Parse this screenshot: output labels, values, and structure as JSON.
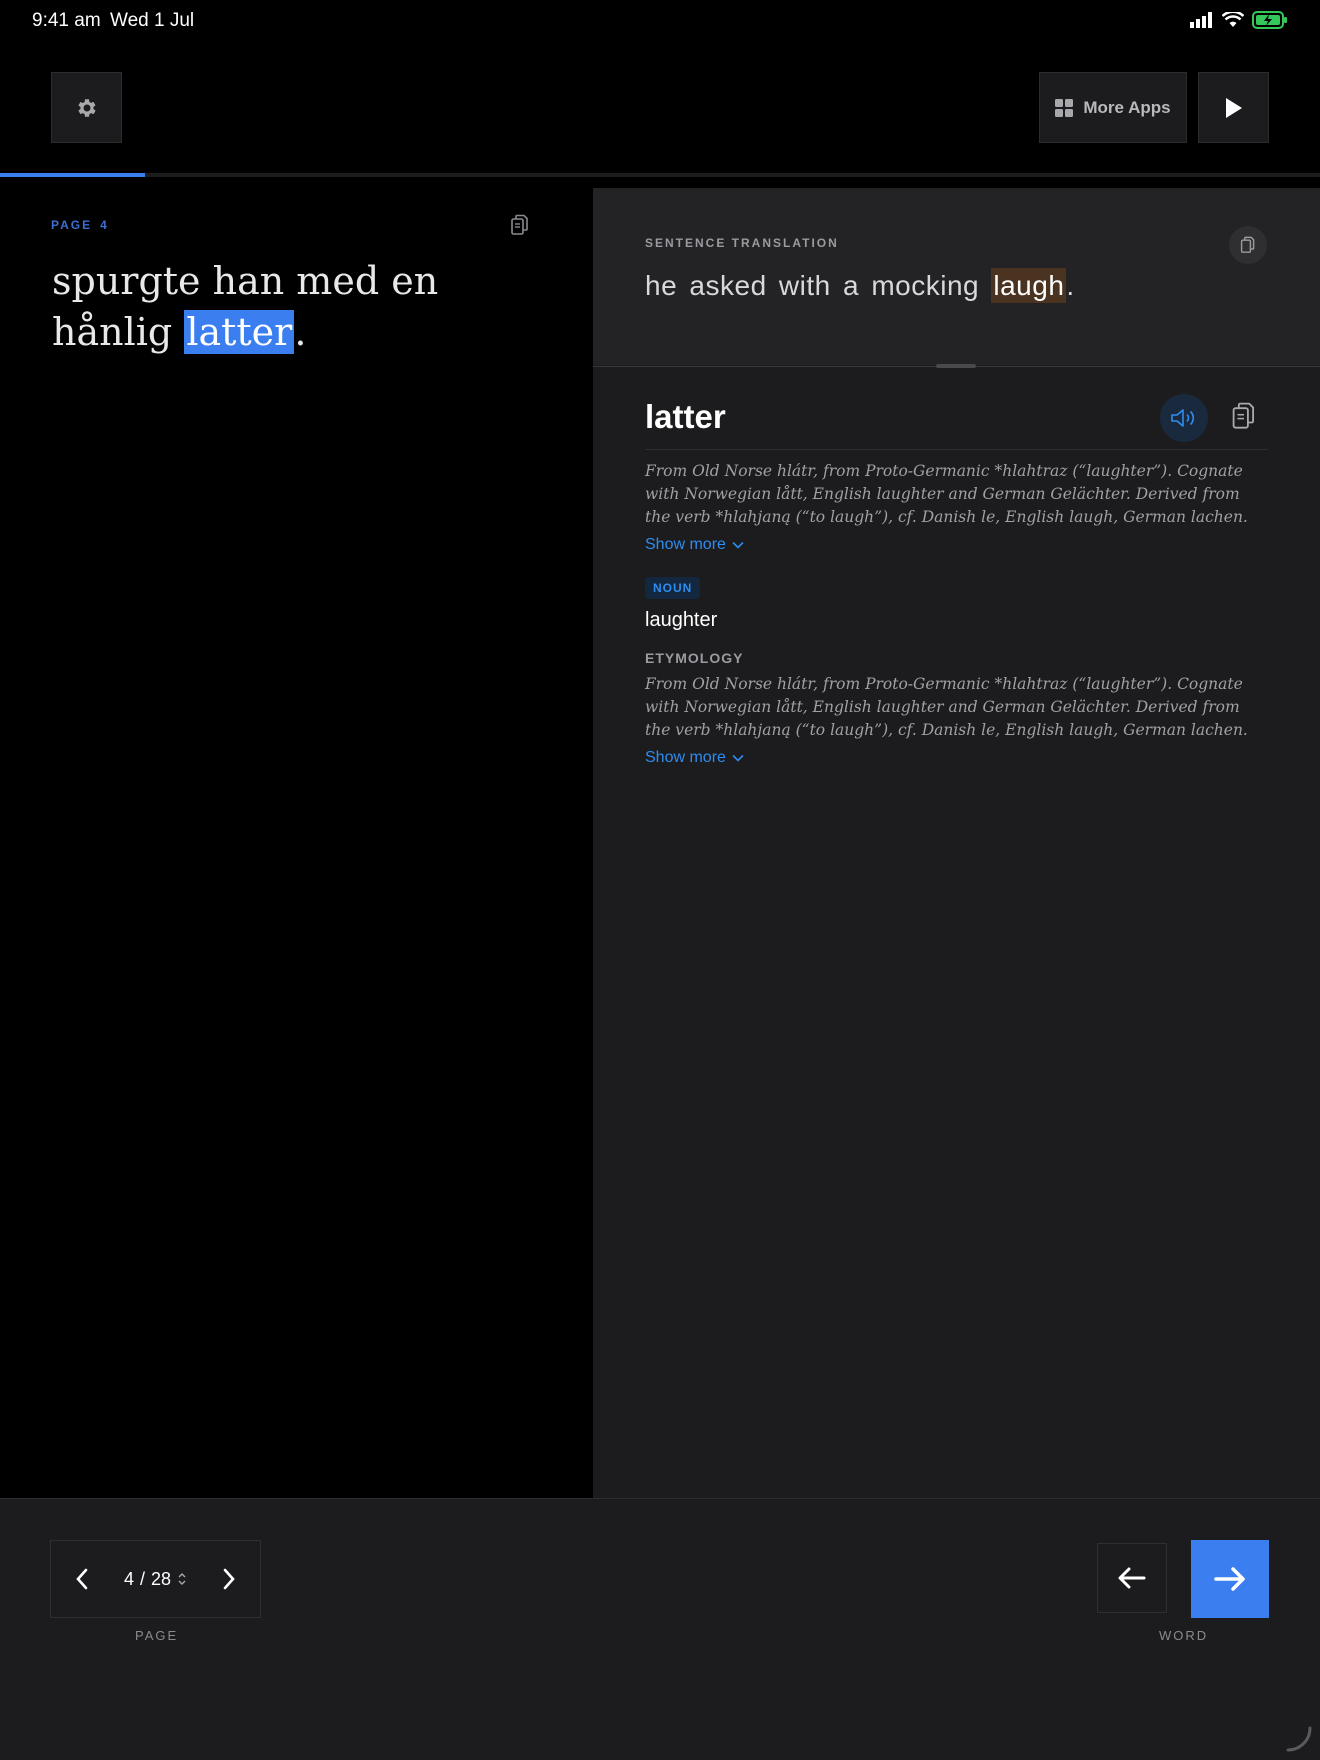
{
  "status_bar": {
    "time": "9:41 am",
    "date": "Wed 1 Jul"
  },
  "toolbar": {
    "more_apps_label": "More Apps"
  },
  "progress": {
    "fraction": 0.11
  },
  "reader": {
    "page_label": "PAGE",
    "page_number": "4",
    "sentence_before": "spurgte han med en hånlig ",
    "highlighted_word": "latter",
    "sentence_after": "."
  },
  "translation": {
    "label": "SENTENCE TRANSLATION",
    "text_before": "he asked with a mocking ",
    "highlighted_word": "laugh",
    "text_after": "."
  },
  "entry": {
    "word": "latter",
    "etymology_summary": "From Old Norse hlátr, from Proto-Germanic *hlahtraz (“laughter”). Cognate with Norwegian lått, English laughter and German Gelächter. Derived from the verb *hlahjaną (“to laugh”), cf. Danish le, English laugh, German lachen.",
    "show_more_label": "Show more",
    "part_of_speech": "NOUN",
    "meaning": "laughter",
    "etymology_label": "ETYMOLOGY",
    "etymology_text": "From Old Norse hlátr, from Proto-Germanic *hlahtraz (“laughter”). Cognate with Norwegian lått, English laughter and German Gelächter. Derived from the verb *hlahjaną (“to laugh”), cf. Danish le, English laugh, German lachen.",
    "show_more_label_2": "Show more"
  },
  "pager": {
    "current": "4",
    "separator": "/",
    "total": "28",
    "caption": "PAGE"
  },
  "word_nav": {
    "caption": "WORD"
  },
  "icons": {
    "settings": "gear-icon",
    "more_apps": "grid-icon",
    "play": "play-icon",
    "copy": "copy-icon",
    "speaker": "speaker-icon",
    "chevron_down": "chevron-down-icon",
    "prev": "chevron-left-icon",
    "next": "chevron-right-icon",
    "back": "arrow-left-icon",
    "forward": "arrow-right-icon"
  },
  "colors": {
    "accent": "#3b7ef0",
    "link": "#2d8df0",
    "translation_highlight": "#4a3320",
    "panel": "#1c1c1e"
  }
}
